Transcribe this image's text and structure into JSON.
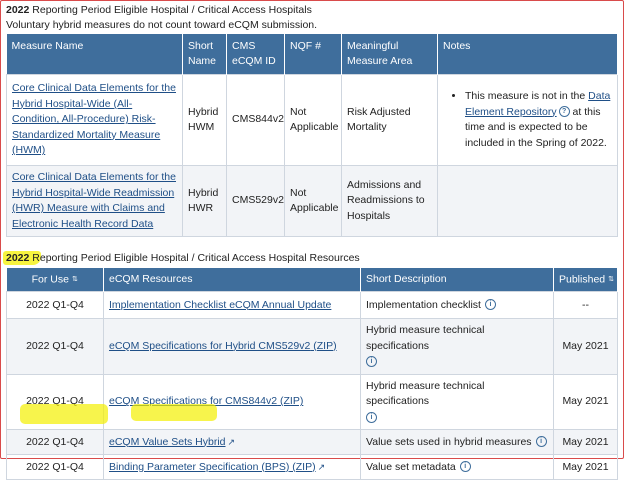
{
  "section1": {
    "year": "2022",
    "heading_rest": " Reporting Period Eligible Hospital / Critical Access Hospitals",
    "subheading": "Voluntary hybrid measures do not count toward eCQM submission.",
    "columns": [
      "Measure Name",
      "Short Name",
      "CMS eCQM ID",
      "NQF #",
      "Meaningful Measure Area",
      "Notes"
    ],
    "rows": [
      {
        "measure_name": "Core Clinical Data Elements for the Hybrid Hospital-Wide (All-Condition, All-Procedure) Risk-Standardized Mortality Measure (HWM)",
        "short_name": "Hybrid HWM",
        "cms_id": "CMS844v2",
        "nqf": "Not Applicable",
        "area": "Risk Adjusted Mortality",
        "note_pre": "This measure is not in the ",
        "note_link": "Data Element Repository",
        "note_post": " at this time and is expected to be included in the Spring of 2022."
      },
      {
        "measure_name": "Core Clinical Data Elements for the Hybrid Hospital-Wide Readmission (HWR) Measure with Claims and Electronic Health Record Data",
        "short_name": "Hybrid HWR",
        "cms_id": "CMS529v2",
        "nqf": "Not Applicable",
        "area": "Admissions and Readmissions to Hospitals",
        "note": ""
      }
    ]
  },
  "section2": {
    "year": "2022",
    "heading_rest": " Reporting Period Eligible Hospital / Critical Access Hospital Resources",
    "columns": [
      "For Use",
      "eCQM Resources",
      "Short Description",
      "Published"
    ],
    "rows": [
      {
        "for_use": "2022 Q1-Q4",
        "resource": "Implementation Checklist eCQM Annual Update",
        "resource_suffix": "",
        "description": "Implementation checklist",
        "published": "--"
      },
      {
        "for_use": "2022 Q1-Q4",
        "resource": "eCQM Specifications for Hybrid CMS529v2",
        "resource_suffix": " (ZIP)",
        "description": "Hybrid measure technical specifications",
        "published": "May 2021"
      },
      {
        "for_use": "2022 Q1-Q4",
        "resource": "eCQM Specifications for CMS844v2",
        "resource_suffix": " (ZIP)",
        "description": "Hybrid measure technical specifications",
        "published": "May 2021"
      },
      {
        "for_use": "2022 Q1-Q4",
        "resource": "eCQM Value Sets Hybrid",
        "resource_suffix": "",
        "description": "Value sets used in hybrid measures",
        "published": "May 2021"
      },
      {
        "for_use": "2022 Q1-Q4",
        "resource": "Binding Parameter Specification (BPS)",
        "resource_suffix": " (ZIP)",
        "description": "Value set metadata",
        "published": "May 2021"
      }
    ]
  },
  "colors": {
    "header_bg": "#3f6e9c",
    "link": "#1f4f87",
    "highlight": "#f4f000",
    "frame_border": "#d94b4b"
  },
  "icons": {
    "info": "info-circle-icon",
    "help": "question-circle-icon",
    "external": "external-link-icon",
    "sort": "sort-icon"
  }
}
